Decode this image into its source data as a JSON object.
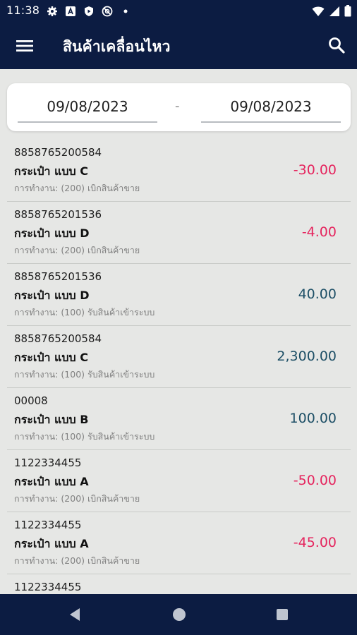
{
  "status_bar": {
    "time": "11:38"
  },
  "app_bar": {
    "title": "สินค้าเคลื่อนไหว"
  },
  "date_range": {
    "from": "09/08/2023",
    "separator": "-",
    "to": "09/08/2023"
  },
  "transactions": [
    {
      "code": "8858765200584",
      "name": "กระเป๋า แบบ C",
      "operation": "การทำงาน: (200) เบิกสินค้าขาย",
      "amount": "-30.00"
    },
    {
      "code": "8858765201536",
      "name": "กระเป๋า แบบ D",
      "operation": "การทำงาน: (200) เบิกสินค้าขาย",
      "amount": "-4.00"
    },
    {
      "code": "8858765201536",
      "name": "กระเป๋า แบบ D",
      "operation": "การทำงาน: (100) รับสินค้าเข้าระบบ",
      "amount": "40.00"
    },
    {
      "code": "8858765200584",
      "name": "กระเป๋า แบบ C",
      "operation": "การทำงาน: (100) รับสินค้าเข้าระบบ",
      "amount": "2,300.00"
    },
    {
      "code": "00008",
      "name": "กระเป๋า แบบ B",
      "operation": "การทำงาน: (100) รับสินค้าเข้าระบบ",
      "amount": "100.00"
    },
    {
      "code": "1122334455",
      "name": "กระเป๋า แบบ A",
      "operation": "การทำงาน: (200) เบิกสินค้าขาย",
      "amount": "-50.00"
    },
    {
      "code": "1122334455",
      "name": "กระเป๋า แบบ A",
      "operation": "การทำงาน: (200) เบิกสินค้าขาย",
      "amount": "-45.00"
    },
    {
      "code": "1122334455",
      "name": "",
      "operation": "",
      "amount": ""
    }
  ],
  "colors": {
    "header": "#0c1c42",
    "negative": "#e5255e",
    "positive": "#1d4f66",
    "background": "#e6e7e5"
  },
  "icons": {
    "status": [
      "gear-icon",
      "a-icon",
      "shield-play-icon",
      "at-icon",
      "dot-icon",
      "wifi-icon",
      "signal-icon",
      "battery-icon"
    ],
    "app_bar": [
      "menu-icon",
      "search-icon"
    ],
    "nav": [
      "back-icon",
      "home-icon",
      "recents-icon"
    ]
  }
}
